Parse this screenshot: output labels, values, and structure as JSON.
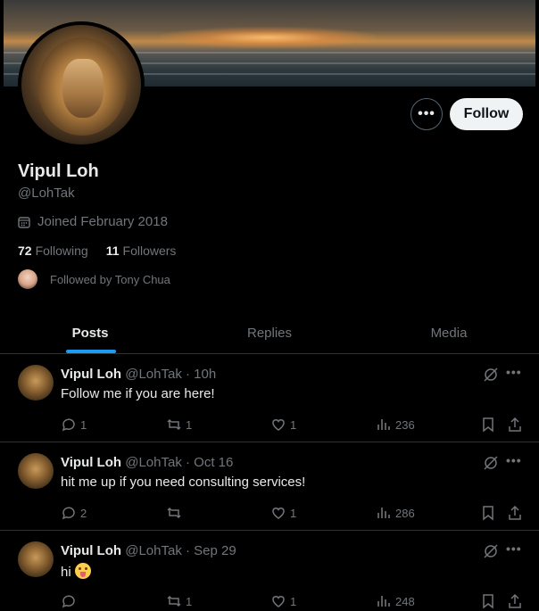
{
  "profile": {
    "name": "Vipul Loh",
    "handle": "@LohTak",
    "joined": "Joined February 2018",
    "following_count": "72",
    "following_label": "Following",
    "followers_count": "11",
    "followers_label": "Followers",
    "followed_by": "Followed by Tony Chua",
    "follow_button": "Follow",
    "more_button": "•••"
  },
  "tabs": [
    {
      "label": "Posts",
      "active": true
    },
    {
      "label": "Replies",
      "active": false
    },
    {
      "label": "Media",
      "active": false
    }
  ],
  "posts": [
    {
      "name": "Vipul Loh",
      "meta": "@LohTak · 10h",
      "text": "Follow me if you are here!",
      "replies": "1",
      "reposts": "1",
      "likes": "1",
      "views": "236"
    },
    {
      "name": "Vipul Loh",
      "meta": "@LohTak · Oct 16",
      "text": "hit me up if you need consulting services!",
      "replies": "2",
      "reposts": "",
      "likes": "1",
      "views": "286"
    },
    {
      "name": "Vipul Loh",
      "meta": "@LohTak · Sep 29",
      "text": "hi",
      "replies": "",
      "reposts": "1",
      "likes": "1",
      "views": "248"
    }
  ],
  "icons": {
    "calendar": "calendar-icon",
    "reply": "reply-icon",
    "repost": "repost-icon",
    "like": "heart-icon",
    "views": "views-icon",
    "bookmark": "bookmark-icon",
    "share": "share-icon",
    "grok": "grok-icon",
    "more": "more-icon"
  },
  "colors": {
    "accent": "#1d9bf0",
    "muted": "#71767b",
    "text": "#e7e9ea",
    "border": "#2f3336"
  }
}
